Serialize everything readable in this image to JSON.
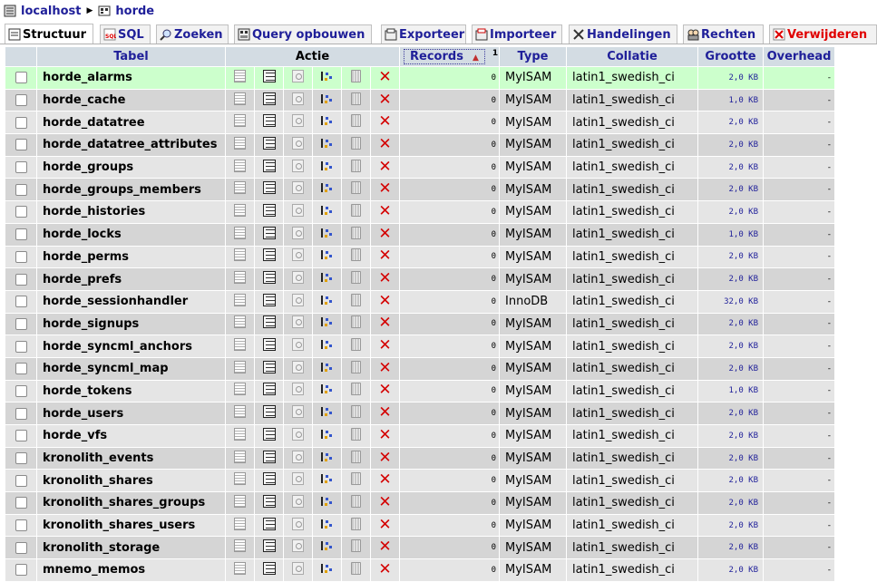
{
  "breadcrumb": {
    "server": "localhost",
    "database": "horde"
  },
  "tabs": [
    {
      "label": "Structuur",
      "active": true
    },
    {
      "label": "SQL"
    },
    {
      "label": "Zoeken"
    },
    {
      "label": "Query opbouwen"
    },
    {
      "label": "Exporteer"
    },
    {
      "label": "Importeer"
    },
    {
      "label": "Handelingen"
    },
    {
      "label": "Rechten"
    },
    {
      "label": "Verwijderen"
    }
  ],
  "table": {
    "headers": {
      "tabel": "Tabel",
      "actie": "Actie",
      "records": "Records",
      "records_sup": "1",
      "type": "Type",
      "collatie": "Collatie",
      "grootte": "Grootte",
      "overhead": "Overhead"
    },
    "rows": [
      {
        "name": "horde_alarms",
        "records": "0",
        "type": "MyISAM",
        "collation": "latin1_swedish_ci",
        "size": "2,0 KB",
        "overhead": "-"
      },
      {
        "name": "horde_cache",
        "records": "0",
        "type": "MyISAM",
        "collation": "latin1_swedish_ci",
        "size": "1,0 KB",
        "overhead": "-"
      },
      {
        "name": "horde_datatree",
        "records": "0",
        "type": "MyISAM",
        "collation": "latin1_swedish_ci",
        "size": "2,0 KB",
        "overhead": "-"
      },
      {
        "name": "horde_datatree_attributes",
        "records": "0",
        "type": "MyISAM",
        "collation": "latin1_swedish_ci",
        "size": "2,0 KB",
        "overhead": "-"
      },
      {
        "name": "horde_groups",
        "records": "0",
        "type": "MyISAM",
        "collation": "latin1_swedish_ci",
        "size": "2,0 KB",
        "overhead": "-"
      },
      {
        "name": "horde_groups_members",
        "records": "0",
        "type": "MyISAM",
        "collation": "latin1_swedish_ci",
        "size": "2,0 KB",
        "overhead": "-"
      },
      {
        "name": "horde_histories",
        "records": "0",
        "type": "MyISAM",
        "collation": "latin1_swedish_ci",
        "size": "2,0 KB",
        "overhead": "-"
      },
      {
        "name": "horde_locks",
        "records": "0",
        "type": "MyISAM",
        "collation": "latin1_swedish_ci",
        "size": "1,0 KB",
        "overhead": "-"
      },
      {
        "name": "horde_perms",
        "records": "0",
        "type": "MyISAM",
        "collation": "latin1_swedish_ci",
        "size": "2,0 KB",
        "overhead": "-"
      },
      {
        "name": "horde_prefs",
        "records": "0",
        "type": "MyISAM",
        "collation": "latin1_swedish_ci",
        "size": "2,0 KB",
        "overhead": "-"
      },
      {
        "name": "horde_sessionhandler",
        "records": "0",
        "type": "InnoDB",
        "collation": "latin1_swedish_ci",
        "size": "32,0 KB",
        "overhead": "-"
      },
      {
        "name": "horde_signups",
        "records": "0",
        "type": "MyISAM",
        "collation": "latin1_swedish_ci",
        "size": "2,0 KB",
        "overhead": "-"
      },
      {
        "name": "horde_syncml_anchors",
        "records": "0",
        "type": "MyISAM",
        "collation": "latin1_swedish_ci",
        "size": "2,0 KB",
        "overhead": "-"
      },
      {
        "name": "horde_syncml_map",
        "records": "0",
        "type": "MyISAM",
        "collation": "latin1_swedish_ci",
        "size": "2,0 KB",
        "overhead": "-"
      },
      {
        "name": "horde_tokens",
        "records": "0",
        "type": "MyISAM",
        "collation": "latin1_swedish_ci",
        "size": "1,0 KB",
        "overhead": "-"
      },
      {
        "name": "horde_users",
        "records": "0",
        "type": "MyISAM",
        "collation": "latin1_swedish_ci",
        "size": "2,0 KB",
        "overhead": "-"
      },
      {
        "name": "horde_vfs",
        "records": "0",
        "type": "MyISAM",
        "collation": "latin1_swedish_ci",
        "size": "2,0 KB",
        "overhead": "-"
      },
      {
        "name": "kronolith_events",
        "records": "0",
        "type": "MyISAM",
        "collation": "latin1_swedish_ci",
        "size": "2,0 KB",
        "overhead": "-"
      },
      {
        "name": "kronolith_shares",
        "records": "0",
        "type": "MyISAM",
        "collation": "latin1_swedish_ci",
        "size": "2,0 KB",
        "overhead": "-"
      },
      {
        "name": "kronolith_shares_groups",
        "records": "0",
        "type": "MyISAM",
        "collation": "latin1_swedish_ci",
        "size": "2,0 KB",
        "overhead": "-"
      },
      {
        "name": "kronolith_shares_users",
        "records": "0",
        "type": "MyISAM",
        "collation": "latin1_swedish_ci",
        "size": "2,0 KB",
        "overhead": "-"
      },
      {
        "name": "kronolith_storage",
        "records": "0",
        "type": "MyISAM",
        "collation": "latin1_swedish_ci",
        "size": "2,0 KB",
        "overhead": "-"
      },
      {
        "name": "mnemo_memos",
        "records": "0",
        "type": "MyISAM",
        "collation": "latin1_swedish_ci",
        "size": "2,0 KB",
        "overhead": "-"
      }
    ]
  }
}
